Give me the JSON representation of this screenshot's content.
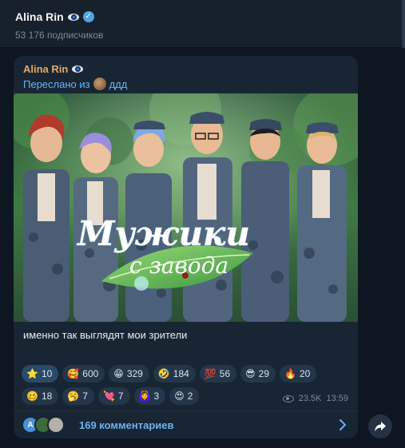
{
  "header": {
    "channel_name": "Alina Rin",
    "subscribers": "53 176 подписчиков"
  },
  "post": {
    "author": "Alina Rin",
    "forwarded_prefix": "Переслано из",
    "forwarded_from": "ддд",
    "image_text_line1": "Мужики",
    "image_text_line2": "с завода",
    "caption": "именно так выглядят мои зрители",
    "reactions": [
      {
        "emoji": "⭐",
        "count": "10",
        "icon": "star-icon"
      },
      {
        "emoji": "🥰",
        "count": "600",
        "icon": "smiling-face-hearts-icon"
      },
      {
        "emoji": "😁",
        "count": "329",
        "icon": "grinning-face-icon"
      },
      {
        "emoji": "🤣",
        "count": "184",
        "icon": "rofl-icon"
      },
      {
        "emoji": "💯",
        "count": "56",
        "icon": "hundred-points-icon"
      },
      {
        "emoji": "😎",
        "count": "29",
        "icon": "sunglasses-face-icon"
      },
      {
        "emoji": "🔥",
        "count": "20",
        "icon": "fire-icon"
      },
      {
        "emoji": "🥴",
        "count": "18",
        "icon": "woozy-face-icon"
      },
      {
        "emoji": "🥱",
        "count": "7",
        "icon": "yawning-face-icon"
      },
      {
        "emoji": "💘",
        "count": "7",
        "icon": "heart-arrow-icon"
      },
      {
        "emoji": "🙆‍♀️",
        "count": "3",
        "icon": "person-gesturing-ok-icon"
      },
      {
        "emoji": "😍",
        "count": "2",
        "icon": "heart-eyes-icon"
      }
    ],
    "views": "23.5K",
    "time": "13:59",
    "comments_avatar_letter": "A",
    "comments_label": "169 комментариев"
  },
  "colors": {
    "background": "#0e1621",
    "bubble": "#182533",
    "accent_link": "#6ab3f3",
    "author_name": "#e7a96a"
  }
}
